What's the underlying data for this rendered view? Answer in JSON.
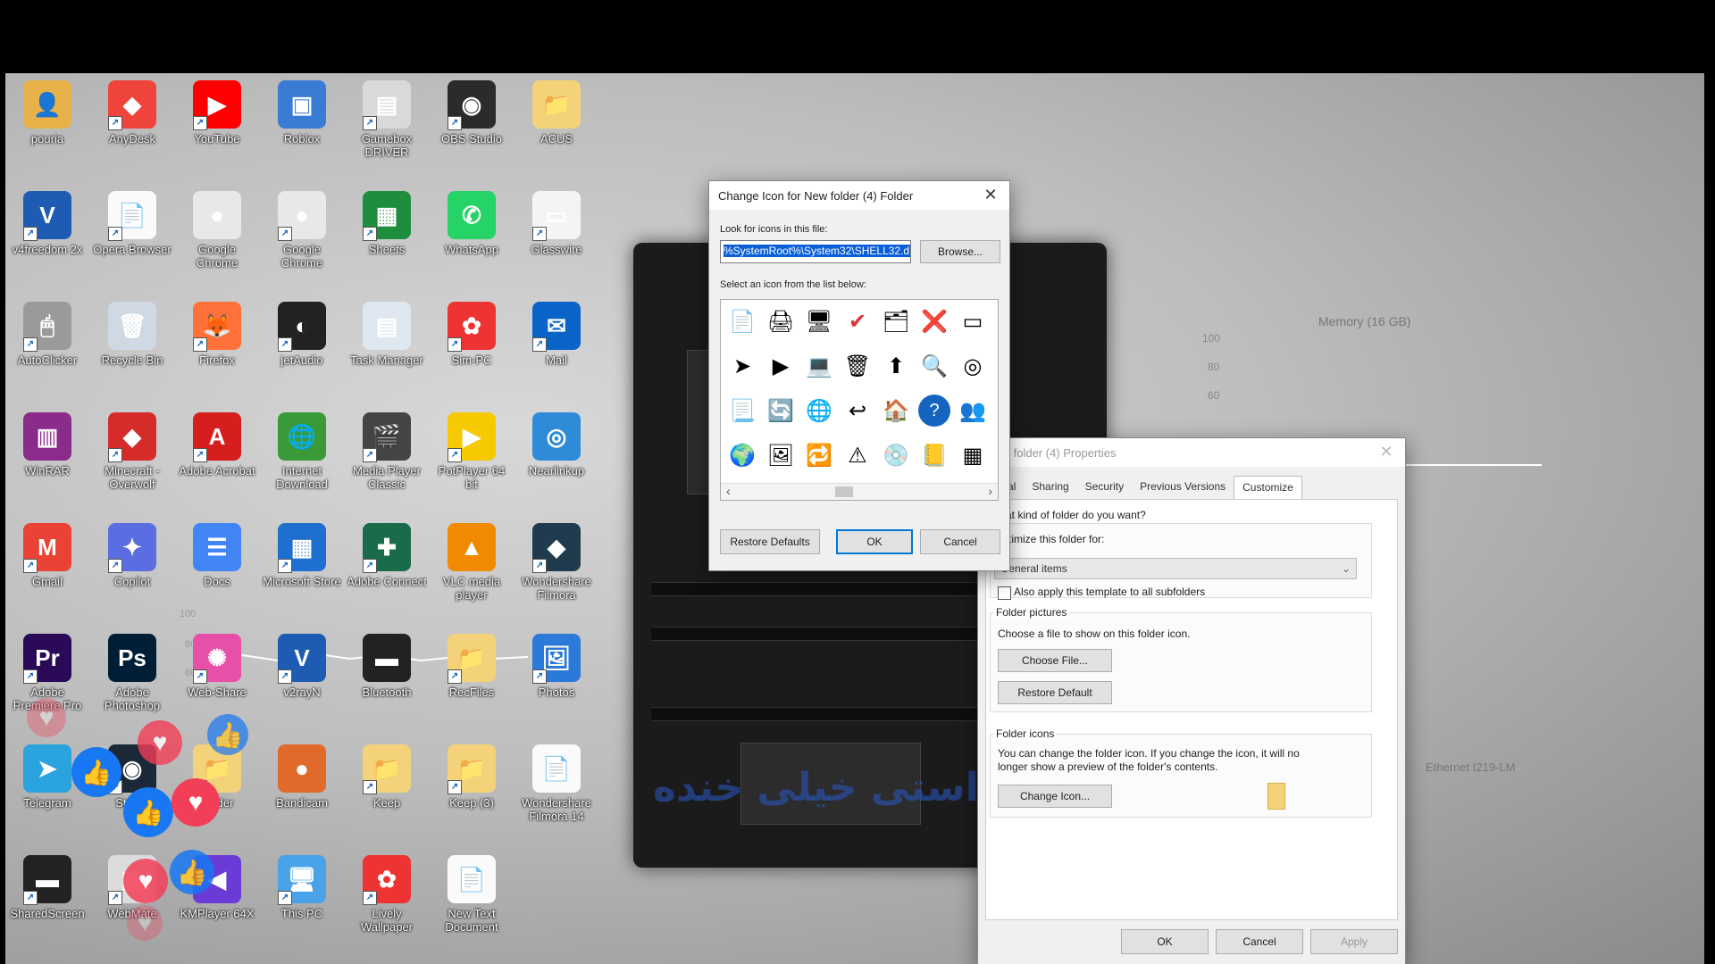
{
  "desktop_icons": [
    {
      "label": "pouria",
      "glyph": "👤",
      "bg": "#e8b14a"
    },
    {
      "label": "AnyDesk",
      "glyph": "◆",
      "bg": "#ef443b"
    },
    {
      "label": "YouTube",
      "glyph": "▶",
      "bg": "#ff0000"
    },
    {
      "label": "Roblox",
      "glyph": "▣",
      "bg": "#3a7bd5"
    },
    {
      "label": "Gamebox DRIVER",
      "glyph": "▤",
      "bg": "#d9d9d9"
    },
    {
      "label": "OBS Studio",
      "glyph": "◉",
      "bg": "#2b2b2b"
    },
    {
      "label": "ACUS",
      "glyph": "📁",
      "bg": "#f3d27a"
    },
    {
      "label": "v4freedom 2x",
      "glyph": "V",
      "bg": "#1e5cb3"
    },
    {
      "label": "Opera Browser",
      "glyph": "📄",
      "bg": "#fafafa"
    },
    {
      "label": "Google Chrome",
      "glyph": "●",
      "bg": "#e8e8e8"
    },
    {
      "label": "Google Chrome",
      "glyph": "●",
      "bg": "#e8e8e8"
    },
    {
      "label": "Sheets",
      "glyph": "▦",
      "bg": "#1e8e3e"
    },
    {
      "label": "WhatsApp",
      "glyph": "✆",
      "bg": "#25d366"
    },
    {
      "label": "Glasswire",
      "glyph": "▭",
      "bg": "#f4f4f4"
    },
    {
      "label": "AutoClicker",
      "glyph": "🖱",
      "bg": "#9a9a9a"
    },
    {
      "label": "Recycle Bin",
      "glyph": "🗑",
      "bg": "#cfd8e3"
    },
    {
      "label": "Firefox",
      "glyph": "🦊",
      "bg": "#ff7139"
    },
    {
      "label": "jetAudio",
      "glyph": "◐",
      "bg": "#222"
    },
    {
      "label": "Task Manager",
      "glyph": "▤",
      "bg": "#dfe8f0"
    },
    {
      "label": "Sim-PC",
      "glyph": "✿",
      "bg": "#e33"
    },
    {
      "label": "Mail",
      "glyph": "✉",
      "bg": "#0a64c8"
    },
    {
      "label": "WinRAR",
      "glyph": "▥",
      "bg": "#8b2b8b"
    },
    {
      "label": "Minecraft - Overwolf",
      "glyph": "◆",
      "bg": "#d62b2b"
    },
    {
      "label": "Adobe Acrobat",
      "glyph": "A",
      "bg": "#d71e1e"
    },
    {
      "label": "Internet Download",
      "glyph": "🌐",
      "bg": "#3a9a3a"
    },
    {
      "label": "Media Player Classic",
      "glyph": "🎬",
      "bg": "#444"
    },
    {
      "label": "PotPlayer 64 bit",
      "glyph": "▶",
      "bg": "#f6c900"
    },
    {
      "label": "Nearlinkup",
      "glyph": "◎",
      "bg": "#2e8bd8"
    },
    {
      "label": "Gmail",
      "glyph": "M",
      "bg": "#ea4335"
    },
    {
      "label": "Copilot",
      "glyph": "✦",
      "bg": "#5b6ee1"
    },
    {
      "label": "Docs",
      "glyph": "☰",
      "bg": "#4285f4"
    },
    {
      "label": "Microsoft Store",
      "glyph": "▦",
      "bg": "#1f6fd1"
    },
    {
      "label": "Adobe Connect",
      "glyph": "✚",
      "bg": "#1a6b4a"
    },
    {
      "label": "VLC media player",
      "glyph": "▲",
      "bg": "#f08a00"
    },
    {
      "label": "Wondershare Filmora",
      "glyph": "◆",
      "bg": "#1f3b4d"
    },
    {
      "label": "Adobe Premiere Pro",
      "glyph": "Pr",
      "bg": "#2a0a57"
    },
    {
      "label": "Adobe Photoshop",
      "glyph": "Ps",
      "bg": "#001e36"
    },
    {
      "label": "Web-Share",
      "glyph": "✺",
      "bg": "#e84fa8"
    },
    {
      "label": "v2rayN",
      "glyph": "V",
      "bg": "#1e5cb3"
    },
    {
      "label": "Bluetooth",
      "glyph": "▬",
      "bg": "#222"
    },
    {
      "label": "RecFiles",
      "glyph": "📁",
      "bg": "#f3d27a"
    },
    {
      "label": "Photos",
      "glyph": "🖼",
      "bg": "#2b79d8"
    },
    {
      "label": "Telegram",
      "glyph": "➤",
      "bg": "#2aa3df"
    },
    {
      "label": "Steam",
      "glyph": "◉",
      "bg": "#1b2838"
    },
    {
      "label": "Folder",
      "glyph": "📁",
      "bg": "#f3d27a"
    },
    {
      "label": "Bandicam",
      "glyph": "●",
      "bg": "#e06a2a"
    },
    {
      "label": "Keep",
      "glyph": "📁",
      "bg": "#f3d27a"
    },
    {
      "label": "Keep (3)",
      "glyph": "📁",
      "bg": "#f3d27a"
    },
    {
      "label": "Wondershare Filmora 14",
      "glyph": "📄",
      "bg": "#fafafa"
    },
    {
      "label": "SharedScreen",
      "glyph": "▬",
      "bg": "#222"
    },
    {
      "label": "WebMate",
      "glyph": "▣",
      "bg": "#dcdcdc"
    },
    {
      "label": "KMPlayer 64X",
      "glyph": "◀",
      "bg": "#6a3bd6"
    },
    {
      "label": "This PC",
      "glyph": "🖥",
      "bg": "#4aa3e8"
    },
    {
      "label": "Lively Wallpaper",
      "glyph": "✿",
      "bg": "#e33"
    },
    {
      "label": "New Text Document",
      "glyph": "📄",
      "bg": "#fafafa"
    }
  ],
  "change_icon_dialog": {
    "title": "Change Icon for New folder (4) Folder",
    "close": "✕",
    "look_label": "Look for icons in this file:",
    "file_path": "%SystemRoot%\\System32\\SHELL32.dll",
    "browse_label": "Browse...",
    "select_label": "Select an icon from the list below:",
    "grid_glyphs": [
      "📄",
      "🖨",
      "🖥",
      "✔",
      "🗂",
      "❌",
      "▭",
      "➤",
      "▶",
      "💻",
      "🗑",
      "⬆",
      "🔍",
      "◎",
      "📃",
      "🔄",
      "🌐",
      "↩",
      "🏠",
      "?",
      "👥",
      "🌍",
      "🖼",
      "🔁",
      "⚠",
      "💿",
      "📒",
      "▦"
    ],
    "scroll_left": "‹",
    "scroll_right": "›",
    "restore_label": "Restore Defaults",
    "ok_label": "OK",
    "cancel_label": "Cancel"
  },
  "properties_dialog": {
    "title": "New folder (4) Properties",
    "close": "✕",
    "tabs": [
      "eneral",
      "Sharing",
      "Security",
      "Previous Versions",
      "Customize"
    ],
    "active_tab": "Customize",
    "kind_label": "What kind of folder do you want?",
    "optimize_label": "Optimize this folder for:",
    "optimize_value": "General items",
    "apply_template_label": "Also apply this template to all subfolders",
    "pictures_label": "Folder pictures",
    "pictures_desc": "Choose a file to show on this folder icon.",
    "choose_file_label": "Choose File...",
    "restore_default_label": "Restore Default",
    "icons_label": "Folder icons",
    "icons_desc1": "You can change the folder icon. If you change the icon, it will no",
    "icons_desc2": "longer show a preview of the folder's contents.",
    "change_icon_label": "Change Icon...",
    "ok_label": "OK",
    "cancel_label": "Cancel",
    "apply_label": "Apply"
  },
  "bg_labels": {
    "memory": "Memory (16 GB)",
    "ticks_right": [
      "100",
      "80",
      "60"
    ],
    "ticks_left": [
      "100",
      "80",
      "60"
    ],
    "ethernet": "Ethernet I219-LM"
  },
  "overlay_text": "راستی خیلی خنده",
  "reactions": {
    "like": "👍",
    "heart": "♥"
  },
  "colors": {
    "accent": "#0078d7",
    "selection": "#0a5fd6"
  }
}
